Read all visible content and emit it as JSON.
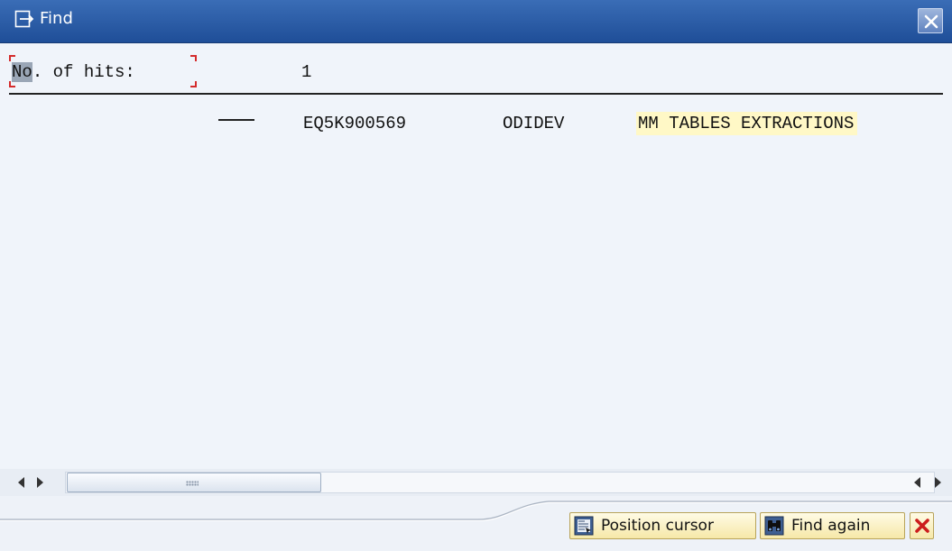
{
  "window": {
    "title": "Find",
    "close_icon": "close-icon"
  },
  "summary": {
    "hits_label_highlight": "No",
    "hits_label_rest": ". of hits:",
    "hits_value": "1"
  },
  "results": [
    {
      "transport": "EQ5K900569",
      "owner": "ODIDEV",
      "description": "MM TABLES EXTRACTIONS"
    }
  ],
  "scrollbar": {
    "left_arrow_icon": "arrow-left-icon",
    "right_arrow_icon": "arrow-right-icon"
  },
  "buttons": {
    "position_cursor": "Position cursor",
    "find_again": "Find again",
    "cancel_icon": "cancel-icon"
  },
  "colors": {
    "titlebar": "#2a5ca8",
    "highlight": "#fff8c6",
    "button_bg": "#f6e8a8",
    "cancel_red": "#cc1d1d"
  }
}
